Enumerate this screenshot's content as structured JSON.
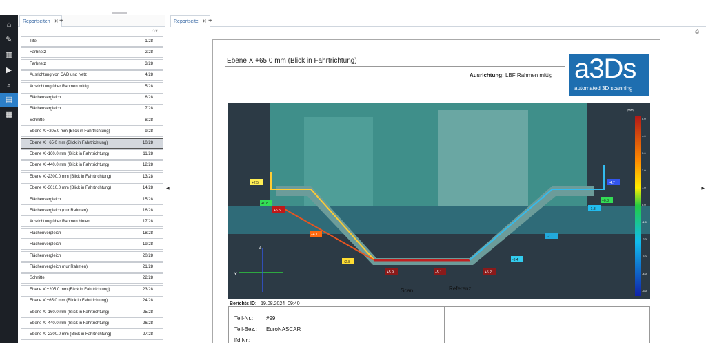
{
  "left_panel": {
    "tab_label": "Reportseiten",
    "tab_close": "✕",
    "add_tab": "+",
    "items": [
      {
        "label": "Titel",
        "num": "1/28"
      },
      {
        "label": "Farbnetz",
        "num": "2/28"
      },
      {
        "label": "Farbnetz",
        "num": "3/28"
      },
      {
        "label": "Ausrichtung von CAD und Netz",
        "num": "4/28"
      },
      {
        "label": "Ausrichtung über Rahmen mittig",
        "num": "5/28"
      },
      {
        "label": "Flächenvergleich",
        "num": "6/28"
      },
      {
        "label": "Flächenvergleich",
        "num": "7/28"
      },
      {
        "label": "Schnitte",
        "num": "8/28"
      },
      {
        "label": "Ebene X +205.0 mm  (Blick in Fahrtrichtung)",
        "num": "9/28"
      },
      {
        "label": "Ebene X +65.0 mm  (Blick in Fahrtrichtung)",
        "num": "10/28"
      },
      {
        "label": "Ebene X -160.0 mm  (Blick in Fahrtrichtung)",
        "num": "11/28"
      },
      {
        "label": "Ebene X -440.0 mm  (Blick in Fahrtrichtung)",
        "num": "12/28"
      },
      {
        "label": "Ebene X -2300.0 mm  (Blick in Fahrtrichtung)",
        "num": "13/28"
      },
      {
        "label": "Ebene X -3010.0 mm  (Blick in Fahrtrichtung)",
        "num": "14/28"
      },
      {
        "label": "Flächenvergleich",
        "num": "15/28"
      },
      {
        "label": "Flächenvergleich (nur Rahmen)",
        "num": "16/28"
      },
      {
        "label": "Ausrichtung über Rahmen hinten",
        "num": "17/28"
      },
      {
        "label": "Flächenvergleich",
        "num": "18/28"
      },
      {
        "label": "Flächenvergleich",
        "num": "19/28"
      },
      {
        "label": "Flächenvergleich",
        "num": "20/28"
      },
      {
        "label": "Flächenvergleich (nur Rahmen)",
        "num": "21/28"
      },
      {
        "label": "Schnitte",
        "num": "22/28"
      },
      {
        "label": "Ebene X +205.0 mm  (Blick in Fahrtrichtung)",
        "num": "23/28"
      },
      {
        "label": "Ebene X +65.0 mm  (Blick in Fahrtrichtung)",
        "num": "24/28"
      },
      {
        "label": "Ebene X -160.0 mm  (Blick in Fahrtrichtung)",
        "num": "25/28"
      },
      {
        "label": "Ebene X -440.0 mm  (Blick in Fahrtrichtung)",
        "num": "26/28"
      },
      {
        "label": "Ebene X -2300.0 mm  (Blick in Fahrtrichtung)",
        "num": "27/28"
      }
    ],
    "selected_index": 9
  },
  "right_panel": {
    "tab_label": "Reportseite",
    "tab_close": "✕",
    "add_tab": "+"
  },
  "report": {
    "title": "Ebene X +65.0 mm  (Blick in Fahrtrichtung)",
    "orientation_label": "Ausrichtung:",
    "orientation_value": "LBF Rahmen mittig",
    "logo_big": "a3Ds",
    "logo_small": "automated 3D scanning",
    "berichts_label": "Berichts ID:",
    "berichts_value": "_19.08.2024_09:40",
    "info": [
      {
        "label": "Teil-Nr.:",
        "value": "#99"
      },
      {
        "label": "Teil-Bez.:",
        "value": "EuroNASCAR"
      },
      {
        "label": "lfd.Nr.:",
        "value": ""
      }
    ]
  },
  "scan": {
    "legend_unit": "[mm]",
    "legend_ticks": [
      "5.0",
      "4.0",
      "3.0",
      "2.0",
      "1.0",
      "0.0",
      "-1.0",
      "-2.0",
      "-3.0",
      "-4.0",
      "-5.0"
    ],
    "annotations": [
      "+2.5",
      "+0.8",
      "+5.5",
      "+4.1",
      "+2.8",
      "+5.9",
      "+5.1",
      "+5.2",
      "-3.4",
      "-2.1",
      "-1.8",
      "+0.8",
      "-4.7"
    ],
    "label_scan": "Scan",
    "label_ref": "Referenz",
    "axis_z": "Z",
    "axis_y": "Y"
  },
  "colors": {
    "accent": "#2c7fc8",
    "logo_bg": "#1e6eb0",
    "mesh": "#3f8f8a",
    "deviation_red": "#8b1a1a"
  },
  "icons": {
    "sidebar": [
      "home-icon",
      "wrench-icon",
      "barcode-icon",
      "camera-icon",
      "search-icon",
      "report-icon",
      "grid-icon"
    ]
  }
}
